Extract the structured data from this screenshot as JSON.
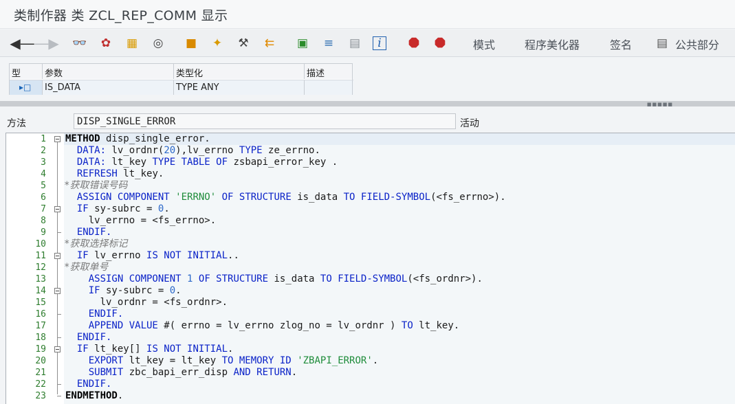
{
  "window": {
    "title": "类制作器 类 ZCL_REP_COMM 显示"
  },
  "toolbar": {
    "icons": [
      "back-arrow-icon",
      "forward-arrow-icon",
      "glasses-display-icon",
      "activate-icon",
      "object-list-icon",
      "where-used-icon",
      "check-icon",
      "wand-icon",
      "tools-icon",
      "navigate-icon",
      "hierarchy-icon",
      "align-icon",
      "doc-icon",
      "info-icon",
      "stop-icon",
      "user-stop-icon"
    ],
    "buttons": {
      "mode": "模式",
      "pretty_printer": "程序美化器",
      "signature": "签名",
      "public_section": "公共部分"
    }
  },
  "params_table": {
    "headers": [
      "型",
      "参数",
      "类型化",
      "描述"
    ],
    "rows": [
      {
        "type": "▸□",
        "param": "IS_DATA",
        "typing": "TYPE ANY",
        "desc": ""
      }
    ]
  },
  "method": {
    "label": "方法",
    "name": "DISP_SINGLE_ERROR",
    "status": "活动"
  },
  "editor": {
    "line_numbers": [
      "1",
      "2",
      "3",
      "4",
      "5",
      "6",
      "7",
      "8",
      "9",
      "10",
      "11",
      "12",
      "13",
      "14",
      "15",
      "16",
      "17",
      "18",
      "19",
      "20",
      "21",
      "22",
      "23"
    ]
  },
  "colors": {
    "keyword": "#0a22c8",
    "string": "#1e8c3a",
    "number": "#2b68c9",
    "comment": "#7a7a7a",
    "line_number": "#2e7d2e"
  }
}
